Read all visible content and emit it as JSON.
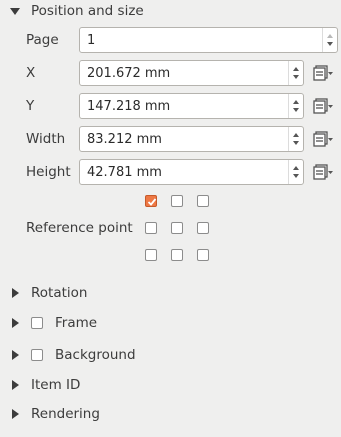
{
  "position_size": {
    "title": "Position and size",
    "page": {
      "label": "Page",
      "value": "1"
    },
    "x": {
      "label": "X",
      "value": "201.672 mm"
    },
    "y": {
      "label": "Y",
      "value": "147.218 mm"
    },
    "width": {
      "label": "Width",
      "value": "83.212 mm"
    },
    "height": {
      "label": "Height",
      "value": "42.781 mm"
    },
    "reference_point": {
      "label": "Reference point",
      "checked_index": 0
    }
  },
  "sections": {
    "rotation": "Rotation",
    "frame": "Frame",
    "background": "Background",
    "item_id": "Item ID",
    "rendering": "Rendering"
  },
  "colors": {
    "accent": "#ee7844",
    "panel_bg": "#efefee"
  },
  "icons": {
    "expanded": "triangle-down-icon",
    "collapsed": "triangle-right-icon",
    "data_defined": "data-defined-override-icon"
  }
}
